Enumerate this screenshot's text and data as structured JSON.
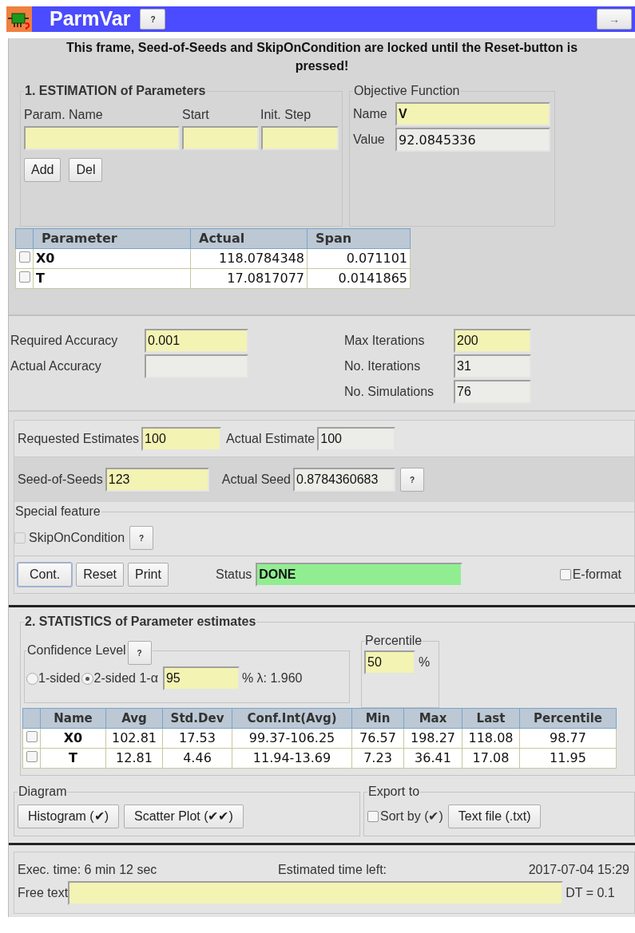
{
  "window": {
    "title": "ParmVar",
    "help_label": "?",
    "nav_label": "→"
  },
  "notice": "This frame, Seed-of-Seeds and SkipOnCondition are locked until the Reset-button is pressed!",
  "estimation": {
    "legend": "1. ESTIMATION of Parameters",
    "columns": [
      "Param. Name",
      "Start",
      "Init. Step"
    ],
    "buttons": [
      "Add",
      "Del"
    ]
  },
  "objective": {
    "legend": "Objective Function",
    "fields": [
      {
        "label": "Name",
        "value": "V",
        "editable": true
      },
      {
        "label": "Value",
        "value": "92.0845336",
        "editable": false
      }
    ]
  },
  "parameters": {
    "columns": [
      "Parameter",
      "Actual",
      "Span"
    ],
    "rows": [
      {
        "checked": false,
        "cells": [
          "X0",
          "118.0784348",
          "0.071101"
        ]
      },
      {
        "checked": false,
        "cells": [
          "T",
          "17.0817077",
          "0.0141865"
        ]
      }
    ]
  },
  "accuracy": {
    "left": [
      {
        "label": "Required Accuracy",
        "value": "0.001",
        "editable": true
      },
      {
        "label": "Actual Accuracy",
        "editable": false
      }
    ],
    "right": [
      {
        "label": "Max Iterations",
        "value": "200",
        "editable": true
      },
      {
        "label": "No. Iterations",
        "value": "31",
        "editable": false
      },
      {
        "label": "No. Simulations",
        "value": "76",
        "editable": false
      }
    ]
  },
  "estimates": [
    {
      "label": "Requested Estimates",
      "value": "100",
      "editable": true
    },
    {
      "label": "Actual Estimate",
      "value": "100",
      "editable": false
    }
  ],
  "seed": {
    "fields": [
      {
        "label": "Seed-of-Seeds",
        "value": "123",
        "editable": true
      },
      {
        "label": "Actual Seed",
        "value": "0.8784360683",
        "editable": false
      }
    ],
    "help_label": "?"
  },
  "special": {
    "legend": "Special feature",
    "option": {
      "label": "SkipOnCondition",
      "checked": false,
      "disabled": true
    },
    "help_label": "?"
  },
  "controls": {
    "buttons": [
      {
        "label": "Cont.",
        "selected": true
      },
      {
        "label": "Reset",
        "selected": false
      },
      {
        "label": "Print",
        "selected": false
      }
    ],
    "status": {
      "label": "Status",
      "value": "DONE"
    },
    "option": {
      "label": "E-format",
      "checked": false,
      "disabled": false
    }
  },
  "statistics": {
    "legend": "2. STATISTICS of Parameter estimates",
    "confidence": {
      "legend": "Confidence Level",
      "help_label": "?",
      "options": [
        {
          "label": "1-sided",
          "selected": false
        },
        {
          "label": "2-sided 1-α",
          "selected": true
        }
      ],
      "value": "95",
      "unit": "% λ: 1.960"
    },
    "percentile": {
      "legend": "Percentile",
      "value": "50",
      "unit": "%"
    },
    "columns": [
      "Name",
      "Avg",
      "Std.Dev",
      "Conf.Int(Avg)",
      "Min",
      "Max",
      "Last",
      "Percentile"
    ],
    "rows": [
      {
        "checked": false,
        "cells": [
          "X0",
          "102.81",
          "17.53",
          "99.37-106.25",
          "76.57",
          "198.27",
          "118.08",
          "98.77"
        ]
      },
      {
        "checked": false,
        "cells": [
          "T",
          "12.81",
          "4.46",
          "11.94-13.69",
          "7.23",
          "36.41",
          "17.08",
          "11.95"
        ]
      }
    ]
  },
  "diagram": {
    "legend": "Diagram",
    "buttons": [
      "Histogram (✔)",
      "Scatter Plot (✔✔)"
    ]
  },
  "export": {
    "legend": "Export to",
    "option": {
      "label": "Sort by (✔)",
      "checked": false,
      "disabled": false
    },
    "button": "Text file (.txt)"
  },
  "footer": {
    "exec_time": "Exec. time: 6 min 12 sec",
    "time_left_label": "Estimated time left:",
    "time_left": "2017-07-04 15:29",
    "free_text_label": "Free text",
    "dt": "DT = 0.1"
  }
}
